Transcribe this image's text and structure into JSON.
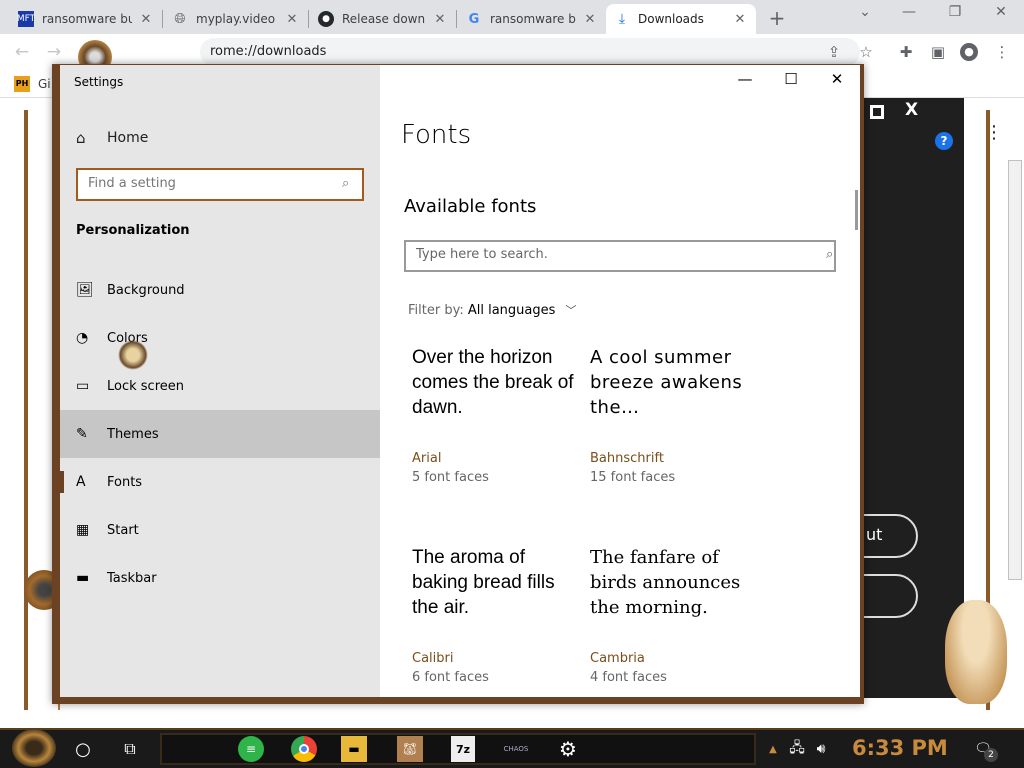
{
  "browser": {
    "tabs": [
      {
        "label": "ransomware bu",
        "icon": "mft-favicon"
      },
      {
        "label": "myplay.video",
        "icon": "globe-icon"
      },
      {
        "label": "Release downlo",
        "icon": "github-icon"
      },
      {
        "label": "ransomware bu",
        "icon": "google-icon"
      },
      {
        "label": "Downloads",
        "icon": "download-icon"
      }
    ],
    "new_tab": "+",
    "address": "chrome://downloads",
    "address_visible": "rome://downloads",
    "bookmark_label": "Gi",
    "bookmark_icon": "PH"
  },
  "settings": {
    "title": "Settings",
    "home": "Home",
    "search_placeholder": "Find a setting",
    "section": "Personalization",
    "nav": [
      {
        "label": "Background",
        "icon": "picture-icon"
      },
      {
        "label": "Colors",
        "icon": "palette-icon"
      },
      {
        "label": "Lock screen",
        "icon": "monitor-icon"
      },
      {
        "label": "Themes",
        "icon": "brush-icon",
        "selected": true
      },
      {
        "label": "Fonts",
        "icon": "font-icon",
        "current": true
      },
      {
        "label": "Start",
        "icon": "tiles-icon"
      },
      {
        "label": "Taskbar",
        "icon": "taskbar-icon"
      }
    ],
    "page_title": "Fonts",
    "available_heading": "Available fonts",
    "font_search_placeholder": "Type here to search.",
    "filter_label": "Filter by:",
    "filter_value": "All languages",
    "fonts": [
      {
        "sample": "Over the horizon comes the break of dawn.",
        "name": "Arial",
        "faces": "5 font faces"
      },
      {
        "sample": "A cool summer breeze awakens the…",
        "name": "Bahnschrift",
        "faces": "15 font faces"
      },
      {
        "sample": "The aroma of baking bread fills the air.",
        "name": "Calibri",
        "faces": "6 font faces"
      },
      {
        "sample": "The fanfare of birds announces the morning.",
        "name": "Cambria",
        "faces": "4 font faces"
      }
    ]
  },
  "overlay": {
    "button_text": "ut",
    "help": "?"
  },
  "taskbar": {
    "clock": "6:33 PM",
    "notif_count": "2",
    "apps": [
      "messages-icon",
      "chrome-icon",
      "folder-icon",
      "hamster-app-icon",
      "7zip-icon",
      "chaos-icon",
      "gear-icon"
    ],
    "chaos_label": "CHAOS",
    "sevenzip_label": "7z"
  },
  "colors": {
    "accent": "#6b4324",
    "sidebar": "#e6e6e6",
    "clock": "#c98a3e"
  }
}
